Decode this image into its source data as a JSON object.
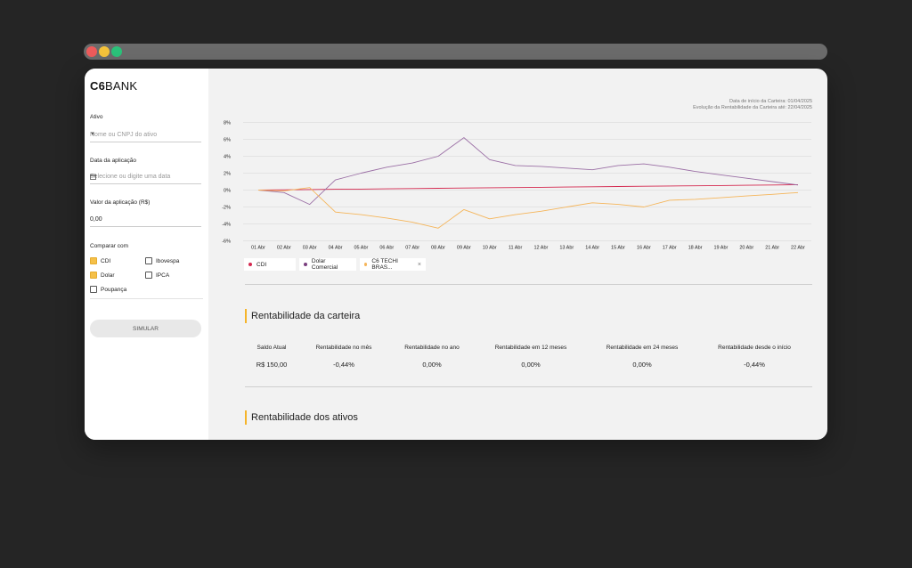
{
  "window_controls": {
    "close_color": "#ee5b5b",
    "minimize_color": "#f5c33b",
    "maximize_color": "#2bc27a"
  },
  "brand": {
    "mark": "C6",
    "name": "BANK"
  },
  "form": {
    "ativo_label": "Ativo",
    "ativo_placeholder": "Nome ou CNPJ do ativo",
    "data_label": "Data da aplicação",
    "data_placeholder": "Selecione ou digite uma data",
    "valor_label": "Valor da aplicação (R$)",
    "valor_value": "0,00",
    "comparar_label": "Comparar com",
    "options": [
      {
        "label": "CDI",
        "checked": true
      },
      {
        "label": "Ibovespa",
        "checked": false
      },
      {
        "label": "Dolar",
        "checked": true
      },
      {
        "label": "IPCA",
        "checked": false
      },
      {
        "label": "Poupança",
        "checked": false
      }
    ],
    "simular_label": "SIMULAR"
  },
  "chart_meta": {
    "start_line": "Data de início da Carteira: 01/04/2025",
    "end_line": "Evolução da Rentabilidade da Carteira até: 22/04/2025"
  },
  "chart_data": {
    "type": "line",
    "categories": [
      "01 Abr",
      "02 Abr",
      "03 Abr",
      "04 Abr",
      "05 Abr",
      "06 Abr",
      "07 Abr",
      "08 Abr",
      "09 Abr",
      "10 Abr",
      "11 Abr",
      "12 Abr",
      "13 Abr",
      "14 Abr",
      "15 Abr",
      "16 Abr",
      "17 Abr",
      "18 Abr",
      "19 Abr",
      "20 Abr",
      "21 Abr",
      "22 Abr"
    ],
    "yticks": [
      "8%",
      "6%",
      "4%",
      "2%",
      "0%",
      "-2%",
      "-4%",
      "-6%"
    ],
    "ylim": [
      -6,
      8
    ],
    "grid": true,
    "series": [
      {
        "name": "CDI",
        "color": "#d4284f",
        "values": [
          0,
          0.03,
          0.06,
          0.09,
          0.12,
          0.15,
          0.18,
          0.21,
          0.24,
          0.27,
          0.3,
          0.33,
          0.36,
          0.39,
          0.42,
          0.45,
          0.48,
          0.51,
          0.54,
          0.57,
          0.6,
          0.63
        ]
      },
      {
        "name": "Dolar Comercial",
        "color": "#9b6fa5",
        "values": [
          0,
          -0.3,
          -1.7,
          1.2,
          2.0,
          2.7,
          3.2,
          4.0,
          6.2,
          3.6,
          2.9,
          2.8,
          2.6,
          2.4,
          2.9,
          3.1,
          2.7,
          2.2,
          1.8,
          1.4,
          1.0,
          0.6
        ]
      },
      {
        "name": "C6 TECHI BRAS...",
        "color": "#f5b55a",
        "values": [
          0,
          -0.1,
          0.3,
          -2.6,
          -2.9,
          -3.3,
          -3.8,
          -4.5,
          -2.3,
          -3.4,
          -2.9,
          -2.5,
          -2.0,
          -1.5,
          -1.7,
          -2.0,
          -1.2,
          -1.1,
          -0.9,
          -0.7,
          -0.5,
          -0.3
        ]
      }
    ]
  },
  "legend": [
    {
      "label": "CDI",
      "color": "#d4284f",
      "removable": false
    },
    {
      "label": "Dolar Comercial",
      "color": "#7a3f7e",
      "removable": false
    },
    {
      "label": "C6 TECHI BRAS...",
      "color": "#f5b55a",
      "removable": true,
      "remove_glyph": "×"
    }
  ],
  "rentabilidade_carteira": {
    "title": "Rentabilidade da carteira",
    "headers": [
      "Saldo Atual",
      "Rentabilidade no mês",
      "Rentabilidade no ano",
      "Rentabilidade em 12 meses",
      "Rentabilidade em 24 meses",
      "Rentabilidade desde o início"
    ],
    "values": [
      "R$ 150,00",
      "-0,44%",
      "0,00%",
      "0,00%",
      "0,00%",
      "-0,44%"
    ]
  },
  "rentabilidade_ativos": {
    "title": "Rentabilidade dos ativos"
  }
}
